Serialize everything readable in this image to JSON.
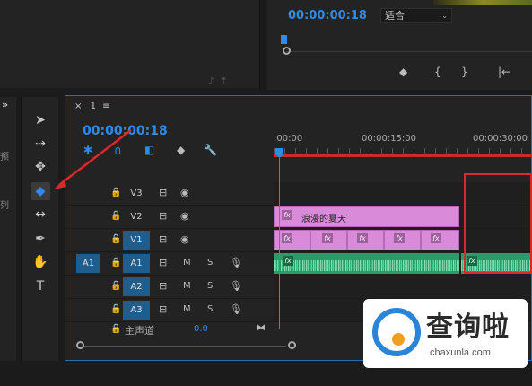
{
  "program_monitor": {
    "timecode": "00:00:00:18",
    "fit_label": "适合",
    "fit_arrow": "⌄",
    "buttons": [
      "◆",
      "{",
      "}",
      "|←"
    ]
  },
  "left_column": {
    "chevron": "»",
    "text_1": "预",
    "text_2": "列"
  },
  "tools": [
    {
      "name": "selection-tool",
      "glyph": "➤"
    },
    {
      "name": "track-select-tool",
      "glyph": "⇢"
    },
    {
      "name": "ripple-edit-tool",
      "glyph": "✥"
    },
    {
      "name": "razor-tool",
      "glyph": "◆"
    },
    {
      "name": "slip-tool",
      "glyph": "↔"
    },
    {
      "name": "pen-tool",
      "glyph": "✒"
    },
    {
      "name": "hand-tool",
      "glyph": "✋"
    },
    {
      "name": "type-tool",
      "glyph": "T"
    }
  ],
  "timeline": {
    "tab_close": "×",
    "tab_name": "1",
    "tab_menu": "≡",
    "timecode": "00:00:00:18",
    "ruler": {
      "labels": [
        ":00:00",
        "00:00:15:00",
        "00:00:30:00"
      ]
    },
    "tracks": {
      "v3": "V3",
      "v2": "V2",
      "v1": "V1",
      "a1_source": "A1",
      "a1": "A1",
      "a2": "A2",
      "a3": "A3",
      "m_label": "M",
      "s_label": "S"
    },
    "title_clip_label": "浪漫的夏天",
    "fx_label": "fx",
    "master": {
      "label": "主声道",
      "value": "0.0"
    }
  },
  "watermark": {
    "text": "查询啦",
    "url": "chaxunla.com"
  },
  "colors": {
    "accent": "#2d8ceb",
    "title_clip": "#d98ad9",
    "audio_clip": "#2a9c6a",
    "highlight_red": "#d62b2b"
  }
}
